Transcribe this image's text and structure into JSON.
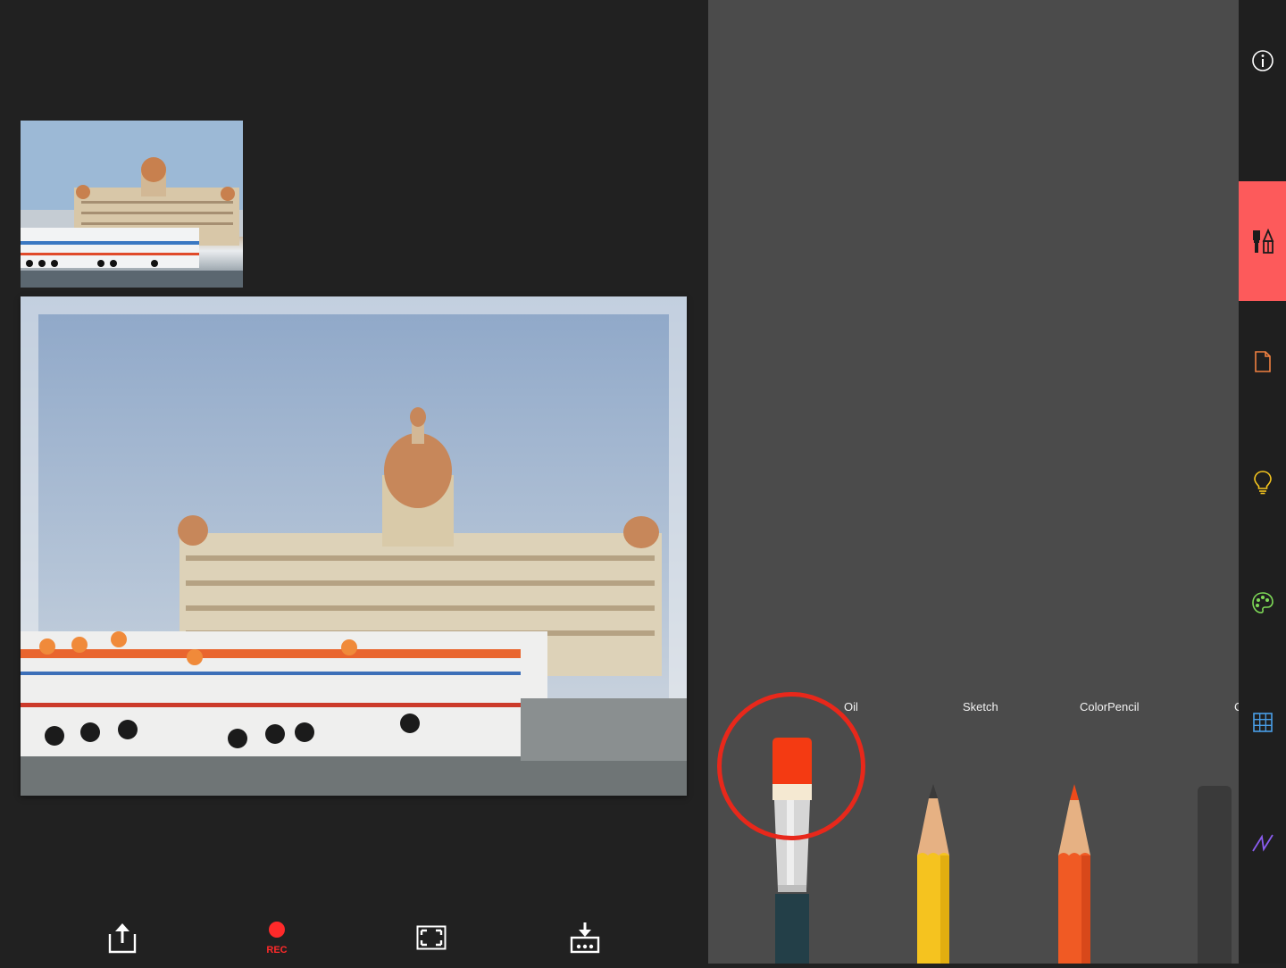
{
  "canvas": {
    "record_label": "REC"
  },
  "brushes": [
    {
      "label": "Oil"
    },
    {
      "label": "Sketch"
    },
    {
      "label": "ColorPencil"
    },
    {
      "label": "C"
    }
  ],
  "icons": {
    "share": "share-icon",
    "record": "record-icon",
    "fullscreen": "fullscreen-icon",
    "save": "save-icon",
    "info": "info-icon",
    "brushes": "brushes-icon",
    "page": "page-icon",
    "light": "lightbulb-icon",
    "palette": "palette-icon",
    "grid": "grid-icon",
    "stroke": "stroke-icon"
  },
  "colors": {
    "accent": "#fd5a5b",
    "highlight": "#e8281b",
    "record": "#ff2a2a"
  }
}
